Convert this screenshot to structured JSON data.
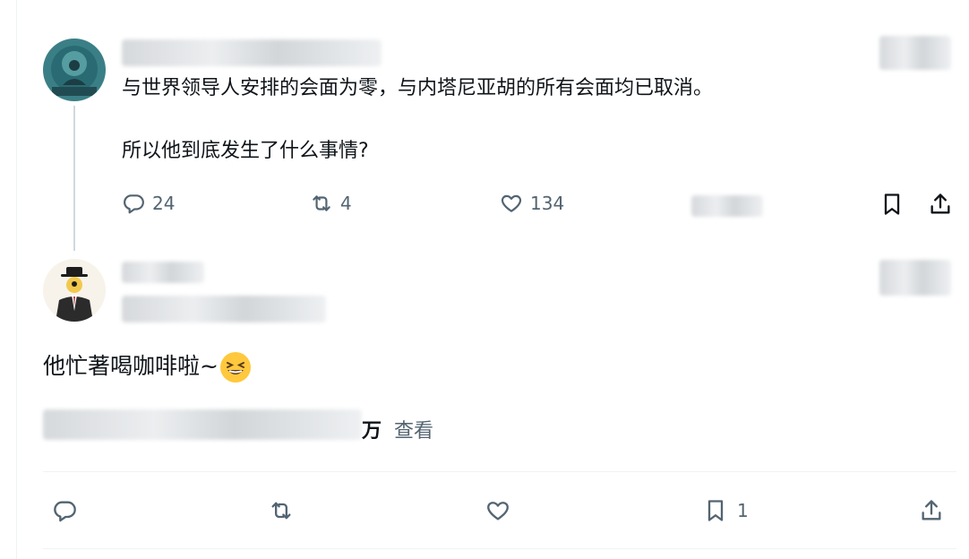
{
  "main_tweet": {
    "author_name": "",
    "text_line1": "与世界领导人安排的会面为零，与内塔尼亚胡的所有会面均已取消。",
    "text_line2": "所以他到底发生了什么事情?",
    "actions": {
      "replies": "24",
      "retweets": "4",
      "likes": "134",
      "views": ""
    },
    "icons": {
      "reply": "reply-icon",
      "retweet": "retweet-icon",
      "like": "heart-icon",
      "views": "views-icon",
      "bookmark": "bookmark-icon",
      "share": "share-icon"
    }
  },
  "reply_tweet": {
    "author_name": "",
    "text": "他忙著喝咖啡啦~",
    "emoji": "grinning-squinting-face",
    "views_count": "万",
    "views_label": "查看"
  },
  "action_bar": {
    "bookmark_count": "1"
  },
  "colors": {
    "text": "#0f1419",
    "secondary": "#536471",
    "divider": "#eff3f4",
    "thread_line": "#cfd9de"
  }
}
